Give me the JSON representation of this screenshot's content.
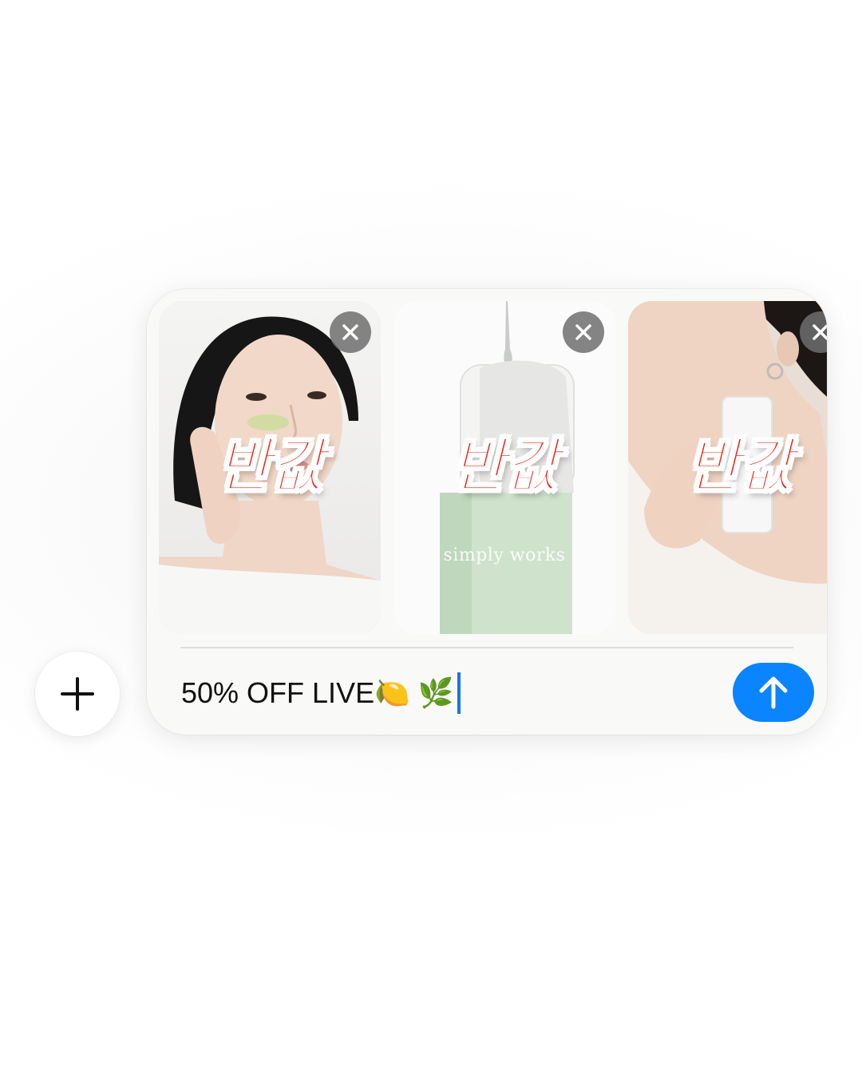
{
  "composer": {
    "message_text": "50% OFF LIVE🍋 🌿",
    "accent_color": "#0a84ff",
    "caret_color": "#1a73e8"
  },
  "attachments": [
    {
      "label": "반값",
      "subject": "woman applying green cream"
    },
    {
      "label": "반값",
      "subject": "mint green product bottle",
      "brand_text": "simply works"
    },
    {
      "label": "반값",
      "subject": "woman holding white product at neck"
    }
  ],
  "icons": {
    "add": "plus-icon",
    "remove": "close-icon",
    "send": "arrow-up-icon"
  },
  "colors": {
    "promo_label": "#ef2d1f",
    "remove_button": "#6e6e6e"
  }
}
